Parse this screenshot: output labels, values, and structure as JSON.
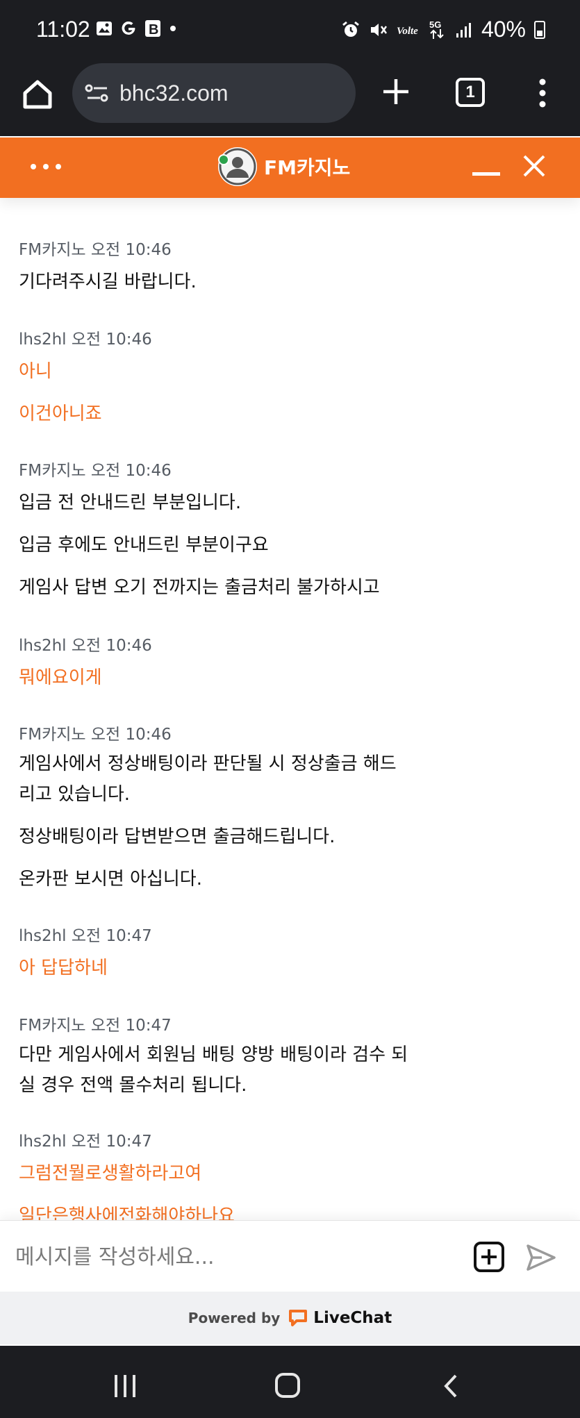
{
  "status_bar": {
    "time": "11:02",
    "battery": "40%",
    "left_icons": [
      "gallery-icon",
      "google-icon",
      "b-app-icon",
      "dot-icon"
    ],
    "right_icons": [
      "alarm-icon",
      "mute-icon",
      "volte-icon",
      "5g-icon",
      "signal-icon",
      "battery-icon"
    ]
  },
  "browser": {
    "url": "bhc32.com",
    "tab_count": "1"
  },
  "chat_header": {
    "title": "FM카지노",
    "online_color": "#2ca24c",
    "accent": "#f26f21"
  },
  "messages": [
    {
      "author": "FM카지노",
      "time": "오전 10:46",
      "mine": false,
      "lines": [
        "기다려주시길 바랍니다."
      ]
    },
    {
      "author": "lhs2hl",
      "time": "오전 10:46",
      "mine": true,
      "lines": [
        "아니",
        "이건아니죠"
      ]
    },
    {
      "author": "FM카지노",
      "time": "오전 10:46",
      "mine": false,
      "lines": [
        "입금 전 안내드린 부분입니다.",
        "입금 후에도 안내드린 부분이구요",
        "게임사 답변 오기 전까지는 출금처리 불가하시고"
      ]
    },
    {
      "author": "lhs2hl",
      "time": "오전 10:46",
      "mine": true,
      "lines": [
        "뭐에요이게"
      ]
    },
    {
      "author": "FM카지노",
      "time": "오전 10:46",
      "mine": false,
      "lines": [
        "게임사에서 정상배팅이라 판단될 시 정상출금 해드",
        "리고 있습니다.",
        "정상배팅이라 답변받으면 출금해드립니다.",
        "온카판 보시면 아십니다."
      ]
    },
    {
      "author": "lhs2hl",
      "time": "오전 10:47",
      "mine": true,
      "lines": [
        "아 답답하네"
      ]
    },
    {
      "author": "FM카지노",
      "time": "오전 10:47",
      "mine": false,
      "lines": [
        "다만 게임사에서 회원님 배팅 양방 배팅이라 검수 되",
        "실 경우 전액 몰수처리 됩니다."
      ]
    },
    {
      "author": "lhs2hl",
      "time": "오전 10:47",
      "mine": true,
      "lines": [
        "그럼전뭘로생활하라고여",
        "일단은행사에전화해야하나요"
      ]
    }
  ],
  "composer": {
    "placeholder": "메시지를 작성하세요..."
  },
  "footer": {
    "powered_by": "Powered by",
    "brand": "LiveChat"
  }
}
